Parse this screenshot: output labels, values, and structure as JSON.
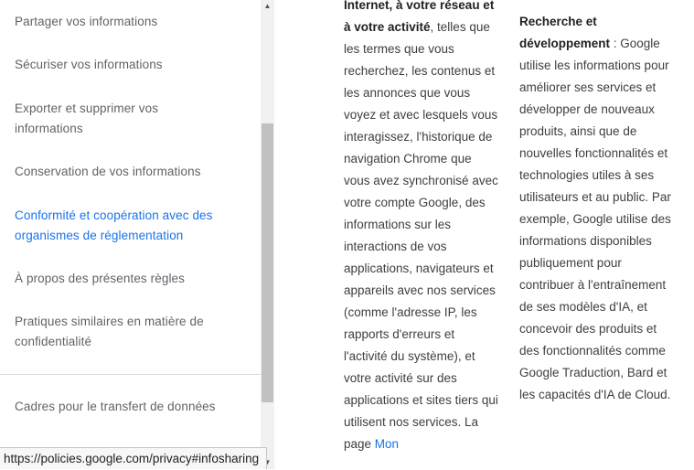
{
  "sidebar": {
    "items": [
      {
        "label": "Partager vos informations",
        "active": false
      },
      {
        "label": "Sécuriser vos informations",
        "active": false
      },
      {
        "label": "Exporter et supprimer vos informations",
        "active": false
      },
      {
        "label": "Conservation de vos informations",
        "active": false
      },
      {
        "label": "Conformité et coopération avec des organismes de réglementation",
        "active": true
      },
      {
        "label": "À propos des présentes règles",
        "active": false
      },
      {
        "label": "Pratiques similaires en matière de confidentialité",
        "active": false
      }
    ],
    "secondary_items": [
      {
        "label": "Cadres pour le transfert de données"
      }
    ]
  },
  "status_bar": {
    "url": "https://policies.google.com/privacy#infosharing"
  },
  "content": {
    "left_column": {
      "bold_lead": "Internet, à votre réseau et à votre activité",
      "text": ", telles que les termes que vous recherchez, les contenus et les annonces que vous voyez et avec lesquels vous interagissez, l'historique de navigation Chrome que vous avez synchronisé avec votre compte Google, des informations sur les interactions de vos applications, navigateurs et appareils avec nos services (comme l'adresse IP, les rapports d'erreurs et l'activité du système), et votre activité sur des applications et sites tiers qui utilisent nos services. La page ",
      "link": "Mon"
    },
    "right_column": {
      "bold_lead": "Recherche et développement",
      "text": " : Google utilise les informations pour améliorer ses services et développer de nouveaux produits, ainsi que de nouvelles fonctionnalités et technologies utiles à ses utilisateurs et au public. Par exemple, Google utilise des informations disponibles publiquement pour contribuer à l'entraînement de ses modèles d'IA, et concevoir des produits et des fonctionnalités comme Google Traduction, Bard et les capacités d'IA de Cloud."
    }
  }
}
